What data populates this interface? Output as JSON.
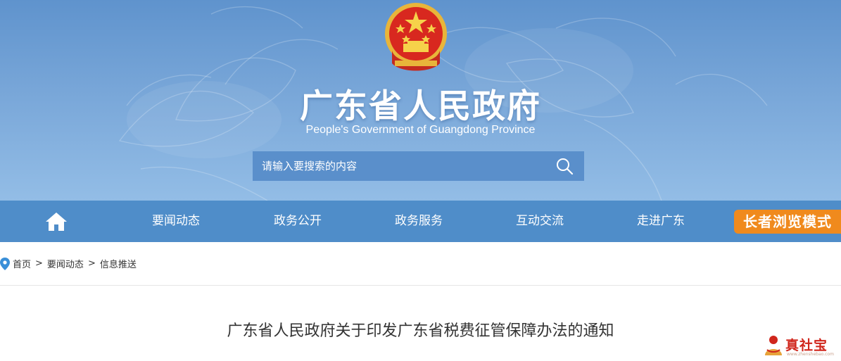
{
  "header": {
    "title": "广东省人民政府",
    "subtitle": "People's Government of Guangdong Province",
    "emblem_icon": "national-emblem-icon"
  },
  "search": {
    "placeholder": "请输入要搜索的内容",
    "icon": "search-icon"
  },
  "nav": {
    "home_icon": "home-icon",
    "items": [
      {
        "label": "要闻动态"
      },
      {
        "label": "政务公开"
      },
      {
        "label": "政务服务"
      },
      {
        "label": "互动交流"
      },
      {
        "label": "走进广东"
      }
    ],
    "elder_mode_label": "长者浏览模式"
  },
  "breadcrumb": {
    "icon": "location-pin-icon",
    "items": [
      "首页",
      "要闻动态",
      "信息推送"
    ],
    "separator": ">"
  },
  "article": {
    "title": "广东省人民政府关于印发广东省税费征管保障办法的通知"
  },
  "watermark": {
    "text": "真社宝",
    "sub": "www.zhenshebao.com"
  },
  "colors": {
    "banner_top": "#5f93cd",
    "banner_bottom": "#93bde6",
    "nav_bg": "#4f8dc9",
    "elder_btn": "#f08a1d",
    "breadcrumb_pin": "#3a8fd8",
    "watermark_red": "#d0261c"
  }
}
